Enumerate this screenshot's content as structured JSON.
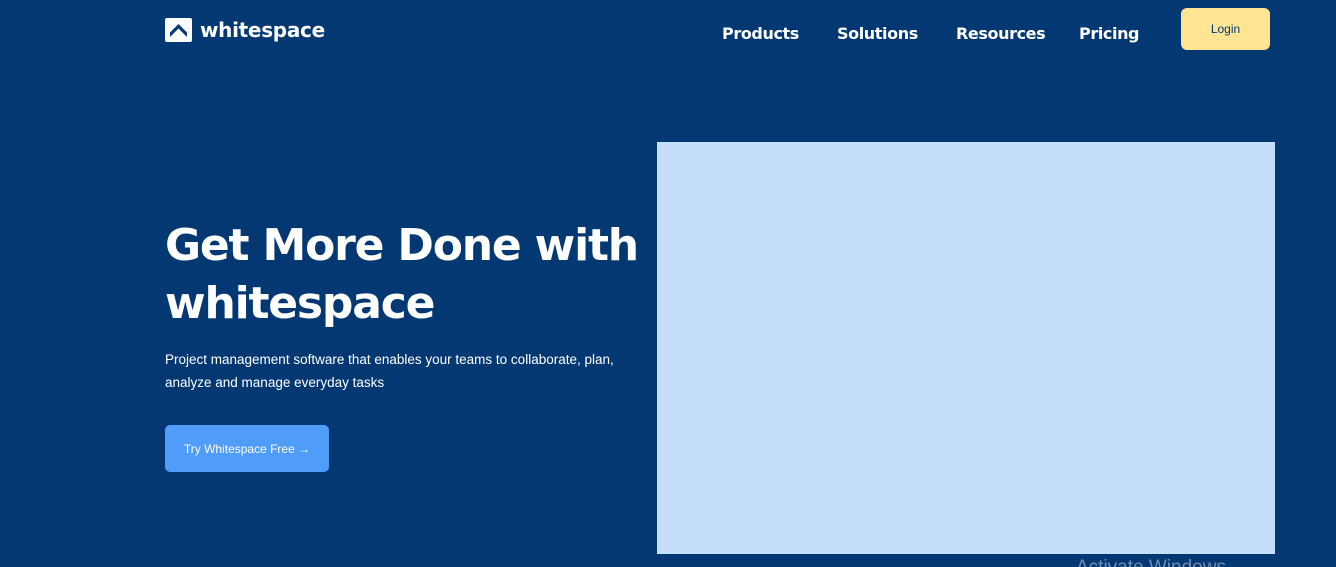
{
  "brand": {
    "name": "whitespace",
    "logo_icon": "whitespace-chevron-icon"
  },
  "nav": {
    "items": [
      {
        "label": "Products"
      },
      {
        "label": "Solutions"
      },
      {
        "label": "Resources"
      },
      {
        "label": "Pricing"
      }
    ],
    "login_label": "Login"
  },
  "hero": {
    "title": "Get More Done with whitespace",
    "subtitle": "Project management software that enables your teams to collaborate, plan, analyze and manage everyday tasks",
    "cta_label": "Try Whitespace Free →",
    "image_placeholder_color": "#C5DFFA"
  },
  "os_watermark": {
    "text": "Activate Windows"
  },
  "colors": {
    "background": "#043873",
    "login_button": "#FFE492",
    "cta_button": "#4F9CF9",
    "text": "#FFFFFF"
  }
}
